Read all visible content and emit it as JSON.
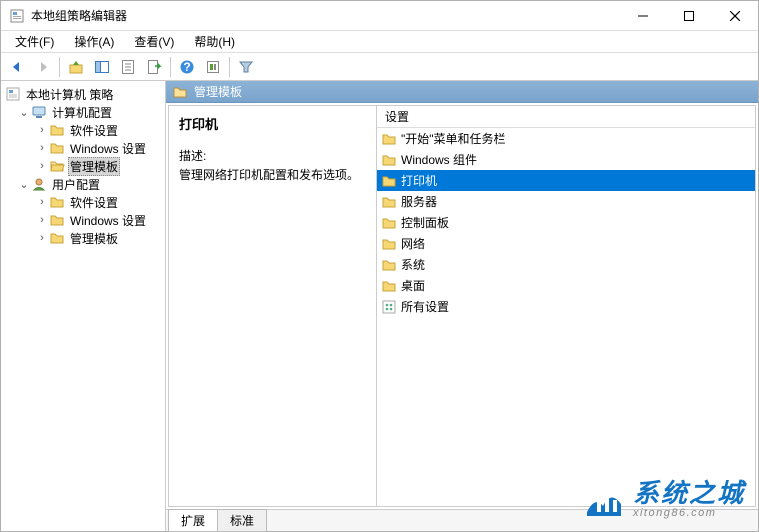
{
  "window": {
    "title": "本地组策略编辑器"
  },
  "menus": {
    "file": "文件(F)",
    "action": "操作(A)",
    "view": "查看(V)",
    "help": "帮助(H)"
  },
  "tree": {
    "root": "本地计算机 策略",
    "computer": "计算机配置",
    "c_soft": "软件设置",
    "c_win": "Windows 设置",
    "c_admin": "管理模板",
    "user": "用户配置",
    "u_soft": "软件设置",
    "u_win": "Windows 设置",
    "u_admin": "管理模板"
  },
  "header": {
    "title": "管理模板"
  },
  "desc": {
    "title": "打印机",
    "label": "描述:",
    "text": "管理网络打印机配置和发布选项。"
  },
  "list": {
    "header": "设置",
    "items": [
      {
        "label": "\"开始\"菜单和任务栏",
        "icon": "folder"
      },
      {
        "label": "Windows 组件",
        "icon": "folder"
      },
      {
        "label": "打印机",
        "icon": "folder",
        "selected": true
      },
      {
        "label": "服务器",
        "icon": "folder"
      },
      {
        "label": "控制面板",
        "icon": "folder"
      },
      {
        "label": "网络",
        "icon": "folder"
      },
      {
        "label": "系统",
        "icon": "folder"
      },
      {
        "label": "桌面",
        "icon": "folder"
      },
      {
        "label": "所有设置",
        "icon": "settings"
      }
    ]
  },
  "tabs": {
    "ext": "扩展",
    "std": "标准"
  },
  "watermark": {
    "cn": "系统之城",
    "en": "xitong86.com"
  }
}
